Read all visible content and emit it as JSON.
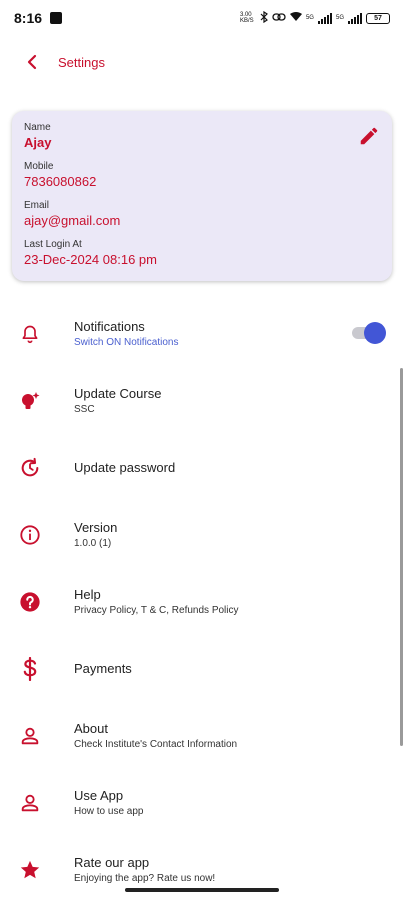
{
  "status_bar": {
    "time": "8:16",
    "speed": "3.00 KB/S",
    "network_1": "5G",
    "network_2": "5G",
    "battery": "57"
  },
  "app_bar": {
    "title": "Settings"
  },
  "profile": {
    "name_label": "Name",
    "name": "Ajay",
    "mobile_label": "Mobile",
    "mobile": "7836080862",
    "email_label": "Email",
    "email": "ajay@gmail.com",
    "last_login_label": "Last Login At",
    "last_login": "23-Dec-2024 08:16 pm"
  },
  "settings": {
    "notifications": {
      "title": "Notifications",
      "subtitle": "Switch ON Notifications",
      "enabled": true
    },
    "update_course": {
      "title": "Update Course",
      "subtitle": "SSC"
    },
    "update_password": {
      "title": "Update password"
    },
    "version": {
      "title": "Version",
      "subtitle": "1.0.0 (1)"
    },
    "help": {
      "title": "Help",
      "subtitle": "Privacy Policy, T & C, Refunds Policy"
    },
    "payments": {
      "title": "Payments"
    },
    "about": {
      "title": "About",
      "subtitle": "Check Institute's Contact Information"
    },
    "use_app": {
      "title": "Use App",
      "subtitle": "How to use app"
    },
    "rate_app": {
      "title": "Rate our app",
      "subtitle": "Enjoying the app? Rate us now!"
    }
  },
  "colors": {
    "brand": "#c8102e",
    "accent": "#4256d6",
    "card_bg": "#ebe8f7"
  },
  "icons": {
    "back": "chevron-left-icon",
    "edit": "pencil-icon",
    "notifications": "bell-icon",
    "update_course": "lightbulb-icon",
    "update_password": "lock-reset-icon",
    "version": "info-icon",
    "help": "help-circle-icon",
    "payments": "dollar-icon",
    "about": "person-icon",
    "use_app": "person-icon",
    "rate_app": "star-icon"
  }
}
